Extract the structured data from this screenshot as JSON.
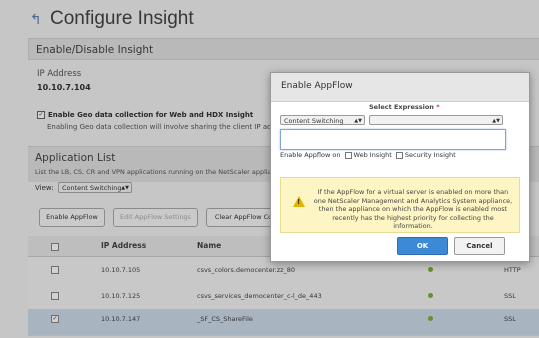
{
  "page": {
    "back_label": "↰",
    "title": "Configure Insight"
  },
  "section": {
    "title": "Enable/Disable Insight",
    "ip_label": "IP Address",
    "ip_value": "10.10.7.104",
    "geo_checkbox_label": "Enable Geo data collection for Web and HDX Insight",
    "geo_desc": "Enabling Geo data collection will involve sharing the client IP addresses wi"
  },
  "app_list": {
    "title": "Application List",
    "desc": "List the LB, CS, CR and VPN applications running on the NetScaler appliance.",
    "view_label": "View:",
    "view_value": "Content Switching",
    "buttons": [
      "Enable AppFlow",
      "Edit AppFlow Settings",
      "Clear AppFlow Co"
    ],
    "columns": [
      "IP Address",
      "Name"
    ],
    "rows": [
      {
        "ip": "10.10.7.105",
        "name": "csvs_colors.democenter.zz_80",
        "protocol": "HTTP",
        "checked": false
      },
      {
        "ip": "10.10.7.125",
        "name": "csvs_services_democenter_c-l_de_443",
        "protocol": "SSL",
        "checked": false
      },
      {
        "ip": "10.10.7.147",
        "name": "_SF_CS_ShareFile",
        "protocol": "SSL",
        "checked": true
      }
    ]
  },
  "modal": {
    "title": "Enable AppFlow",
    "select_expression_label": "Select Expression",
    "required_mark": "*",
    "type_select": "Content Switching",
    "expr_select": "",
    "appflow_on_label": "Enable Appflow on",
    "web_insight_label": "Web Insight",
    "security_insight_label": "Security Insight",
    "warning_text": "If the AppFlow for a virtual server is enabled on more than one NetScaler Management and Analytics System appliance, then the appliance on which the AppFlow is enabled most recently has the highest priority for collecting the information.",
    "ok_label": "OK",
    "cancel_label": "Cancel"
  }
}
